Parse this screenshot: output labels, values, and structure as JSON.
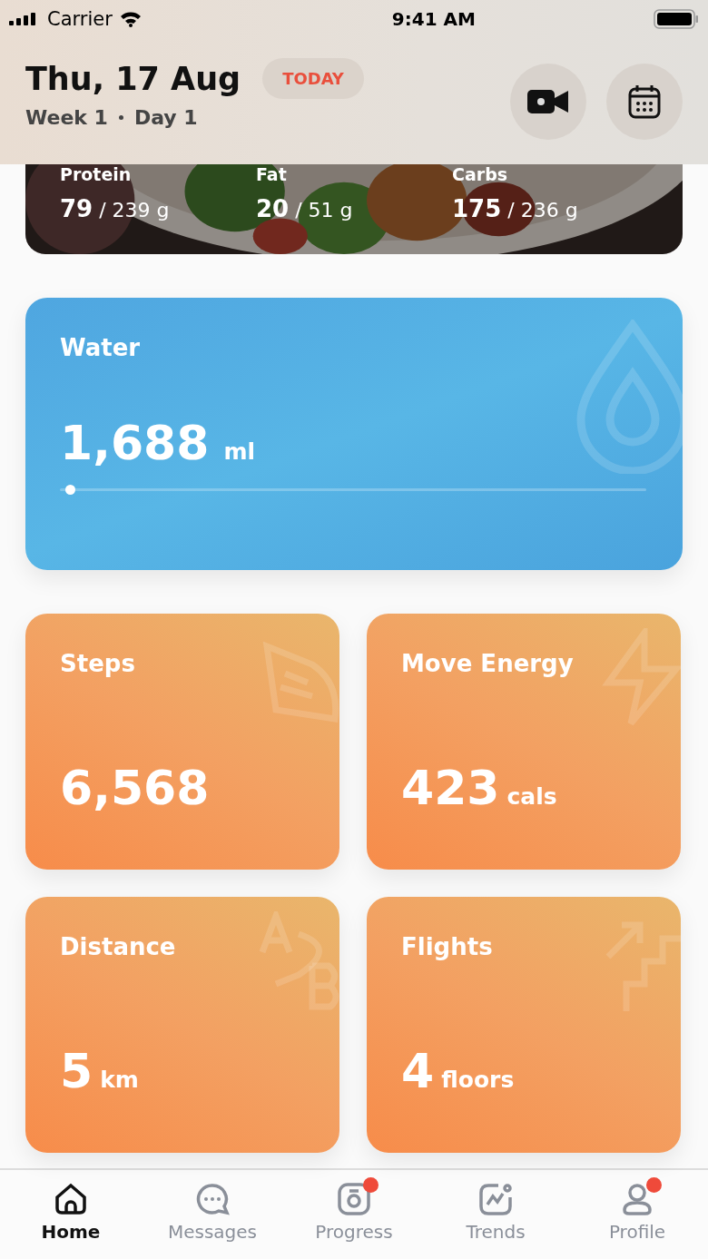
{
  "status_bar": {
    "carrier": "Carrier",
    "time": "9:41 AM"
  },
  "header": {
    "date": "Thu, 17 Aug",
    "badge": "TODAY",
    "week": "Week 1",
    "day": "Day 1"
  },
  "macros": [
    {
      "label": "Protein",
      "value": "79",
      "target": "/ 239 g"
    },
    {
      "label": "Fat",
      "value": "20",
      "target": "/ 51 g"
    },
    {
      "label": "Carbs",
      "value": "175",
      "target": "/ 236 g"
    }
  ],
  "water": {
    "title": "Water",
    "value": "1,688",
    "unit": "ml",
    "level": 0.01
  },
  "tiles": [
    {
      "kind": "steps",
      "title": "Steps",
      "value": "6,568"
    },
    {
      "kind": "energy",
      "title": "Move Energy",
      "value": "423",
      "unit": "cals"
    },
    {
      "kind": "distance",
      "title": "Distance",
      "value": "5",
      "unit": "km"
    },
    {
      "kind": "flights",
      "title": "Flights",
      "value": "4",
      "unit": "floors"
    }
  ],
  "tabs": [
    {
      "kind": "home",
      "label": "Home",
      "selected": true,
      "badge": false
    },
    {
      "kind": "messages",
      "label": "Messages",
      "selected": false,
      "badge": false
    },
    {
      "kind": "progress",
      "label": "Progress",
      "selected": false,
      "badge": true
    },
    {
      "kind": "trends",
      "label": "Trends",
      "selected": false,
      "badge": false
    },
    {
      "kind": "profile",
      "label": "Profile",
      "selected": false,
      "badge": true
    }
  ]
}
